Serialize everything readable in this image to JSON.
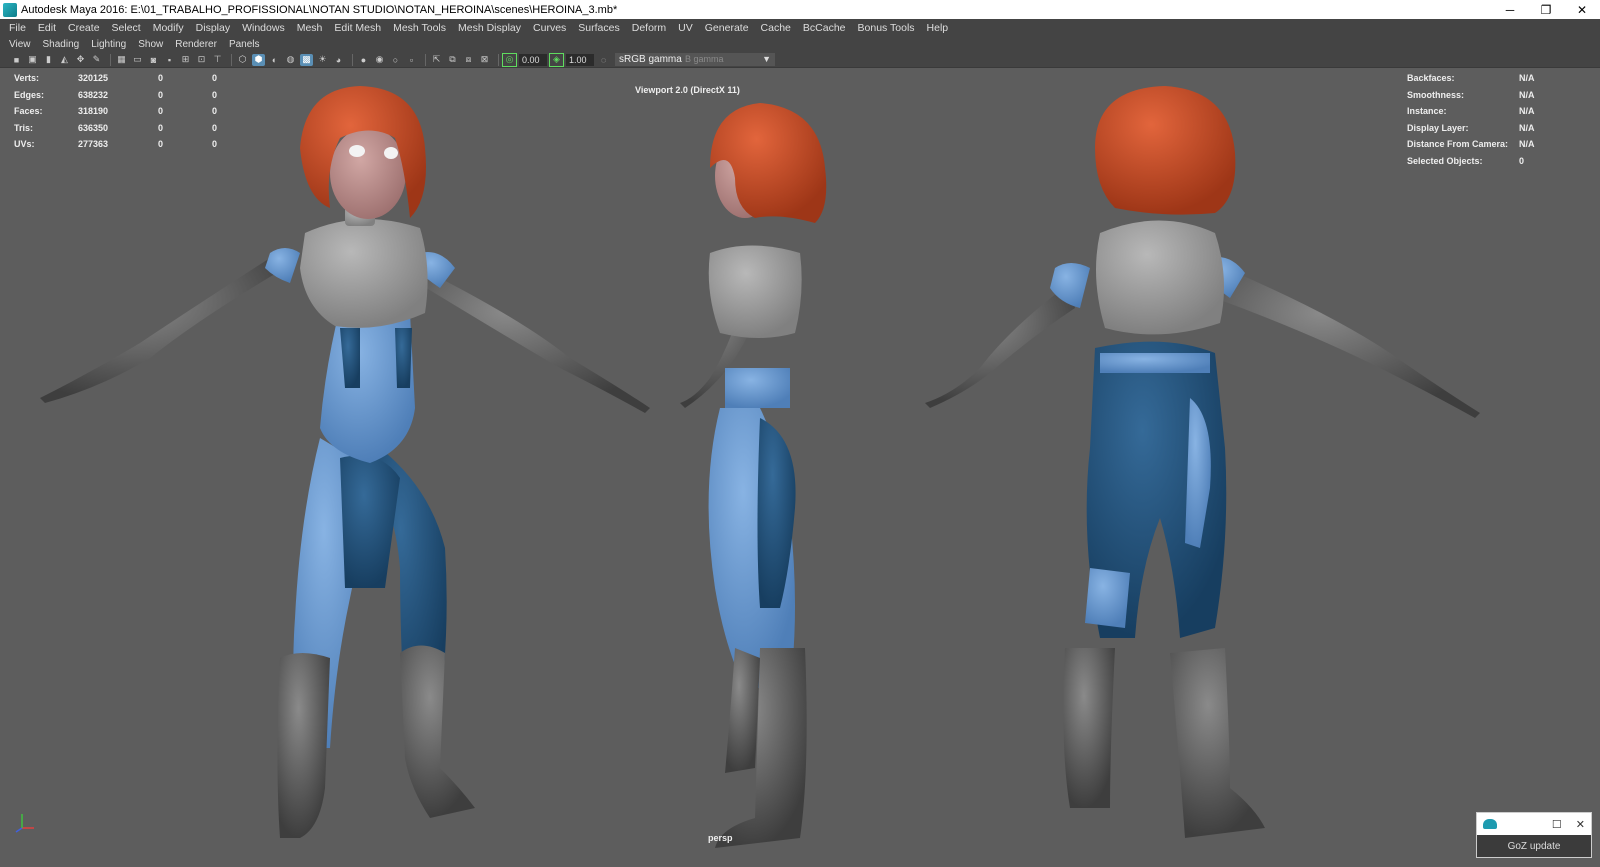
{
  "window": {
    "title": "Autodesk Maya 2016: E:\\01_TRABALHO_PROFISSIONAL\\NOTAN STUDIO\\NOTAN_HEROINA\\scenes\\HEROINA_3.mb*",
    "minimize": "─",
    "restore": "❐",
    "close": "✕"
  },
  "main_menu": [
    "File",
    "Edit",
    "Create",
    "Select",
    "Modify",
    "Display",
    "Windows",
    "Mesh",
    "Edit Mesh",
    "Mesh Tools",
    "Mesh Display",
    "Curves",
    "Surfaces",
    "Deform",
    "UV",
    "Generate",
    "Cache",
    "BcCache",
    "Bonus Tools",
    "Help"
  ],
  "panel_menu": [
    "View",
    "Shading",
    "Lighting",
    "Show",
    "Renderer",
    "Panels"
  ],
  "toolbar": {
    "exposure": "0.00",
    "gamma_value": "1.00",
    "color_space": "sRGB gamma",
    "color_space_ghost": "B gamma"
  },
  "hud_left": [
    {
      "label": "Verts:",
      "v1": "320125",
      "v2": "0",
      "v3": "0"
    },
    {
      "label": "Edges:",
      "v1": "638232",
      "v2": "0",
      "v3": "0"
    },
    {
      "label": "Faces:",
      "v1": "318190",
      "v2": "0",
      "v3": "0"
    },
    {
      "label": "Tris:",
      "v1": "636350",
      "v2": "0",
      "v3": "0"
    },
    {
      "label": "UVs:",
      "v1": "277363",
      "v2": "0",
      "v3": "0"
    }
  ],
  "hud_right": [
    {
      "label": "Backfaces:",
      "value": "N/A"
    },
    {
      "label": "Smoothness:",
      "value": "N/A"
    },
    {
      "label": "Instance:",
      "value": "N/A"
    },
    {
      "label": "Display Layer:",
      "value": "N/A"
    },
    {
      "label": "Distance From Camera:",
      "value": "N/A"
    },
    {
      "label": "Selected Objects:",
      "value": "0"
    }
  ],
  "viewport": {
    "renderer_label": "Viewport 2.0 (DirectX 11)",
    "camera": "persp",
    "background_color": "#5d5d5d"
  },
  "colors": {
    "hair": "#c94a26",
    "suit_dark": "#1f4f78",
    "suit_light": "#5a8cc4",
    "armor": "#9a9a9a",
    "gloves_boots": "#555555",
    "skin": "#b98a88"
  },
  "goz_popup": {
    "button_label": "GoZ update"
  }
}
